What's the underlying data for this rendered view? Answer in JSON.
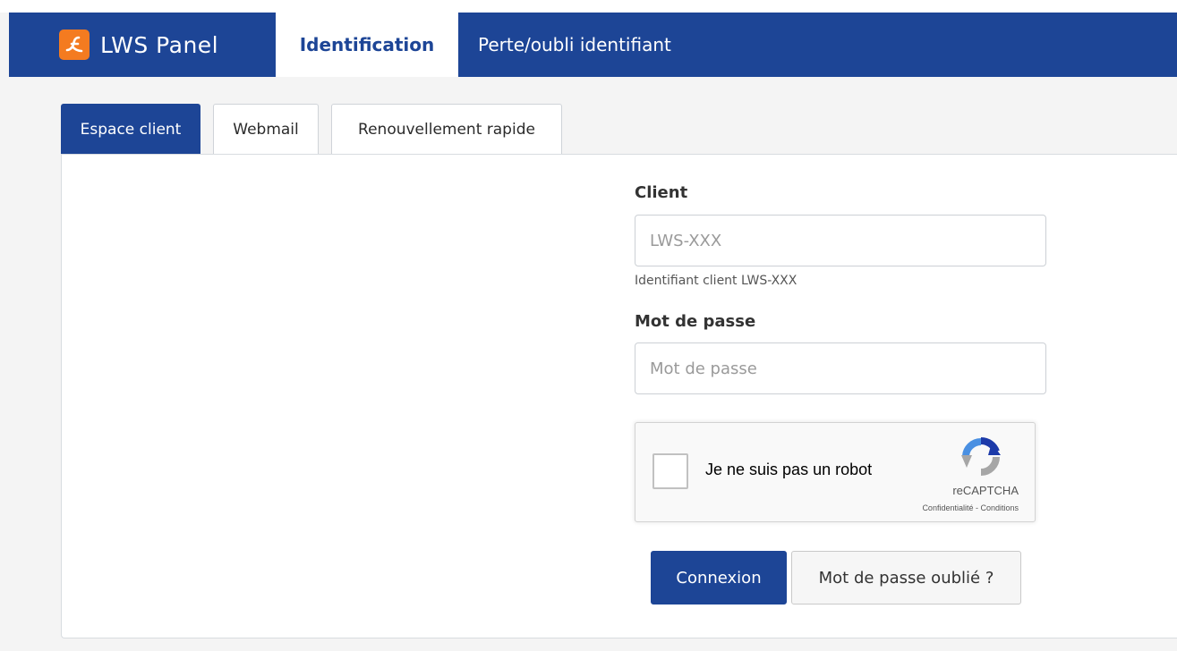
{
  "navbar": {
    "brand": "LWS Panel",
    "items": [
      {
        "label": "Identification",
        "active": true
      },
      {
        "label": "Perte/oubli identifiant",
        "active": false
      }
    ]
  },
  "tabs": [
    {
      "label": "Espace client",
      "active": true
    },
    {
      "label": "Webmail",
      "active": false
    },
    {
      "label": "Renouvellement rapide",
      "active": false
    }
  ],
  "form": {
    "client_label": "Client",
    "client_placeholder": "LWS-XXX",
    "client_help": "Identifiant client LWS-XXX",
    "password_label": "Mot de passe",
    "password_placeholder": "Mot de passe"
  },
  "recaptcha": {
    "label": "Je ne suis pas un robot",
    "brand": "reCAPTCHA",
    "links": "Confidentialité - Conditions",
    "checked": false
  },
  "buttons": {
    "submit": "Connexion",
    "forgot": "Mot de passe oublié ?"
  },
  "colors": {
    "primary": "#1d4596",
    "logo_accent": "#f47b20"
  },
  "icons": {
    "brand": "lws-logo-icon",
    "recaptcha": "recaptcha-logo-icon"
  }
}
